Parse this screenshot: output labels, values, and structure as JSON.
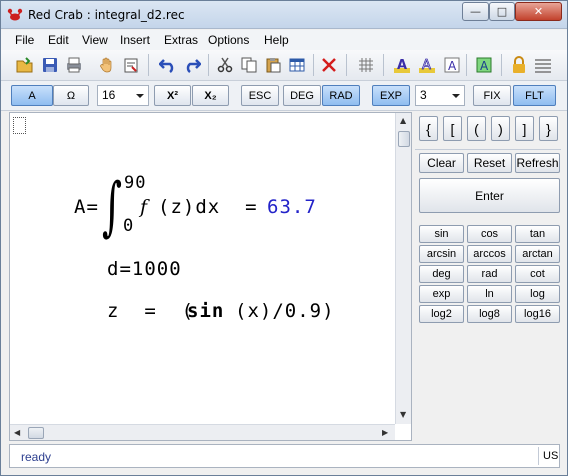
{
  "window": {
    "title": "Red Crab : integral_d2.rec",
    "controls": {
      "minimize": "—",
      "maximize": "□",
      "close": "✕"
    }
  },
  "menu": [
    "File",
    "Edit",
    "View",
    "Insert",
    "Extras",
    "Options",
    "Help"
  ],
  "toolbar_icons": [
    "open-icon",
    "save-icon",
    "print-icon",
    "hand-icon",
    "properties-icon",
    "undo-icon",
    "redo-icon",
    "cut-icon",
    "copy-icon",
    "paste-icon",
    "table-icon",
    "delete-icon",
    "grid-icon",
    "text-a-icon",
    "text-a-outline-icon",
    "text-a-shadow-icon",
    "text-a-green-icon",
    "lock-icon",
    "lines-icon"
  ],
  "colors": {
    "accent": "#2323c9",
    "status": "#2d3f8f",
    "active_button": "#8fbdf0"
  },
  "toolbar2": {
    "btn_a": "A",
    "btn_omega": "Ω",
    "font_size": "16",
    "superscript": "X²",
    "subscript": "X₂",
    "esc": "ESC",
    "deg": "DEG",
    "rad": "RAD",
    "exp": "EXP",
    "precision": "3",
    "fix": "FIX",
    "flt": "FLT"
  },
  "math": {
    "line1_lhs": "A=",
    "upper_limit": "90",
    "lower_limit": "0",
    "integrand": "f",
    "integrand_rest": "(z)dx  =",
    "result": "63.7",
    "line2": "d=1000",
    "line3_a": "z  =  (",
    "line3_fn": "sin",
    "line3_b": "(x)/0.9)"
  },
  "panel": {
    "brackets": [
      "{",
      "[",
      "(",
      ")",
      "]",
      "}"
    ],
    "clear": "Clear",
    "reset": "Reset",
    "refresh": "Refresh",
    "enter": "Enter",
    "functions": [
      [
        "sin",
        "cos",
        "tan"
      ],
      [
        "arcsin",
        "arccos",
        "arctan"
      ],
      [
        "deg",
        "rad",
        "cot"
      ],
      [
        "exp",
        "ln",
        "log"
      ],
      [
        "log2",
        "log8",
        "log16"
      ]
    ]
  },
  "status": {
    "text": "ready",
    "lang": "US"
  }
}
